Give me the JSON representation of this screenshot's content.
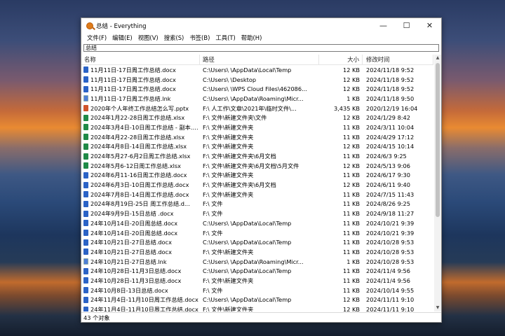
{
  "window": {
    "title": "总结 - Everything"
  },
  "window_buttons": {
    "minimize": "—",
    "maximize": "☐",
    "close": "✕"
  },
  "menu": [
    "文件(F)",
    "编辑(E)",
    "视图(V)",
    "搜索(S)",
    "书签(B)",
    "工具(T)",
    "帮助(H)"
  ],
  "search": {
    "value": "总结"
  },
  "columns": {
    "name": "名称",
    "path": "路径",
    "size": "大小",
    "date": "修改时间"
  },
  "files": [
    {
      "name": "11月11日-17日周工作总结.docx",
      "path": "C:\\Users\\ \\AppData\\Local\\Temp",
      "size": "12 KB",
      "date": "2024/11/18 9:52",
      "icon": "docx"
    },
    {
      "name": "11月11日-17日周工作总结.docx",
      "path": "C:\\Users\\ \\Desktop",
      "size": "12 KB",
      "date": "2024/11/18 9:52",
      "icon": "docx"
    },
    {
      "name": "11月11日-17日周工作总结.docx",
      "path": "C:\\Users\\ \\WPS Cloud Files\\462086...",
      "size": "12 KB",
      "date": "2024/11/18 9:52",
      "icon": "docx"
    },
    {
      "name": "11月11日-17日周工作总结.lnk",
      "path": "C:\\Users\\ \\AppData\\Roaming\\Micr...",
      "size": "1 KB",
      "date": "2024/11/18 9:50",
      "icon": "lnk"
    },
    {
      "name": "2020年个人年终工作总结怎么写.pptx",
      "path": "F:\\ 人工作\\文章\\2021年\\临时文件\\...",
      "size": "3,435 KB",
      "date": "2020/12/19 16:04",
      "icon": "pptx"
    },
    {
      "name": "2024年1月22-28日周工作总结.xlsx",
      "path": "F:\\ 文件\\新建文件夹\\文件",
      "size": "12 KB",
      "date": "2024/1/29 8:42",
      "icon": "xlsx"
    },
    {
      "name": "2024年3月4日-10日周工作总结 - 副本.xlsx",
      "path": "F:\\ 文件\\新建文件夹",
      "size": "11 KB",
      "date": "2024/3/11 10:04",
      "icon": "xlsx"
    },
    {
      "name": "2024年4月22-28日周工作总结.xlsx",
      "path": "F:\\ 文件\\新建文件夹",
      "size": "11 KB",
      "date": "2024/4/29 17:12",
      "icon": "xlsx"
    },
    {
      "name": "2024年4月8日-14日周工作总结.xlsx",
      "path": "F:\\ 文件\\新建文件夹",
      "size": "12 KB",
      "date": "2024/4/15 10:14",
      "icon": "xlsx"
    },
    {
      "name": "2024年5月27-6月2日周工作总结.xlsx",
      "path": "F:\\ 文件\\新建文件夹\\6月文档",
      "size": "11 KB",
      "date": "2024/6/3 9:25",
      "icon": "xlsx"
    },
    {
      "name": "2024年5月6-12日周工作总结.xlsx",
      "path": "F:\\ 文件\\新建文件夹\\6月文档\\5月文件",
      "size": "12 KB",
      "date": "2024/5/13 9:06",
      "icon": "xlsx"
    },
    {
      "name": "2024年6月11-16日周工作总结.docx",
      "path": "F:\\ 文件\\新建文件夹",
      "size": "11 KB",
      "date": "2024/6/17 9:30",
      "icon": "docx"
    },
    {
      "name": "2024年6月3日-10日周工作总结.docx",
      "path": "F:\\ 文件\\新建文件夹\\6月文档",
      "size": "12 KB",
      "date": "2024/6/11 9:40",
      "icon": "docx"
    },
    {
      "name": "2024年7月8日-14日周工作总结.docx",
      "path": "F:\\ 文件\\新建文件夹",
      "size": "11 KB",
      "date": "2024/7/15 11:43",
      "icon": "docx"
    },
    {
      "name": "2024年8月19日-25日 周工作总结.d...",
      "path": "F:\\ 文件",
      "size": "11 KB",
      "date": "2024/8/26 9:25",
      "icon": "docx"
    },
    {
      "name": "2024年9月9日-15日总结 .docx",
      "path": "F:\\ 文件",
      "size": "11 KB",
      "date": "2024/9/18 11:27",
      "icon": "docx"
    },
    {
      "name": "24年10月14日-20日周总结.docx",
      "path": "C:\\Users\\ \\AppData\\Local\\Temp",
      "size": "11 KB",
      "date": "2024/10/21 9:39",
      "icon": "docx"
    },
    {
      "name": "24年10月14日-20日周总结.docx",
      "path": "F:\\ 文件",
      "size": "11 KB",
      "date": "2024/10/21 9:39",
      "icon": "docx"
    },
    {
      "name": "24年10月21日-27日总结.docx",
      "path": "C:\\Users\\ \\AppData\\Local\\Temp",
      "size": "11 KB",
      "date": "2024/10/28 9:53",
      "icon": "docx"
    },
    {
      "name": "24年10月21日-27日总结.docx",
      "path": "F:\\ 文件\\新建文件夹",
      "size": "11 KB",
      "date": "2024/10/28 9:53",
      "icon": "docx"
    },
    {
      "name": "24年10月21日-27日总结.lnk",
      "path": "C:\\Users\\ \\AppData\\Roaming\\Micr...",
      "size": "1 KB",
      "date": "2024/10/28 9:53",
      "icon": "lnk"
    },
    {
      "name": "24年10月28日-11月3日总结.docx",
      "path": "C:\\Users\\ \\AppData\\Local\\Temp",
      "size": "11 KB",
      "date": "2024/11/4 9:56",
      "icon": "docx"
    },
    {
      "name": "24年10月28日-11月3日总结.docx",
      "path": "F:\\ 文件\\新建文件夹",
      "size": "11 KB",
      "date": "2024/11/4 9:56",
      "icon": "docx"
    },
    {
      "name": "24年10月8日-13日总结.docx",
      "path": "F:\\ 文件",
      "size": "11 KB",
      "date": "2024/10/14 9:55",
      "icon": "docx"
    },
    {
      "name": "24年11月4日-11月10日周工作总结.docx",
      "path": "C:\\Users\\ \\AppData\\Local\\Temp",
      "size": "12 KB",
      "date": "2024/11/11 9:10",
      "icon": "docx"
    },
    {
      "name": "24年11月4日-11月10日周工作总结.docx",
      "path": "F:\\ 文件\\新建文件夹",
      "size": "12 KB",
      "date": "2024/11/11 9:10",
      "icon": "docx"
    }
  ],
  "status": {
    "text": "43 个对象"
  }
}
